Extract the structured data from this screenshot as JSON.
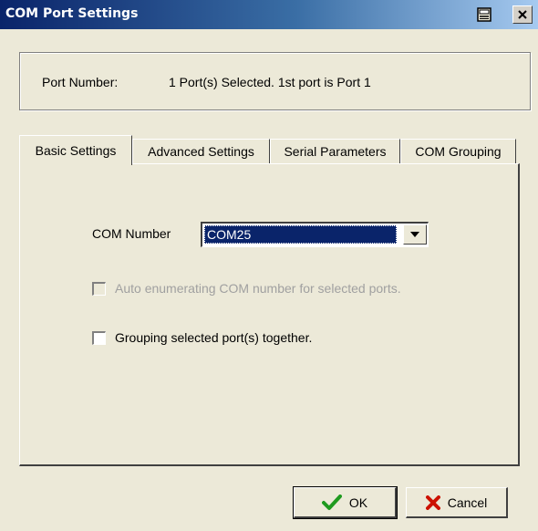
{
  "window": {
    "title": "COM Port Settings"
  },
  "port_info": {
    "label": "Port Number:",
    "value": "1 Port(s) Selected. 1st port is Port 1"
  },
  "tabs": [
    {
      "label": "Basic Settings",
      "active": true
    },
    {
      "label": "Advanced Settings",
      "active": false
    },
    {
      "label": "Serial Parameters",
      "active": false
    },
    {
      "label": "COM Grouping",
      "active": false
    }
  ],
  "basic": {
    "com_label": "COM Number",
    "com_value": "COM25",
    "auto_enum_label": "Auto enumerating COM number for selected ports.",
    "auto_enum_checked": false,
    "auto_enum_enabled": false,
    "grouping_label": "Grouping selected port(s) together.",
    "grouping_checked": false
  },
  "buttons": {
    "ok": "OK",
    "cancel": "Cancel"
  },
  "icons": {
    "print": "print-icon",
    "close": "close-icon",
    "dropdown": "dropdown-arrow-icon",
    "ok": "green-check-icon",
    "cancel": "red-x-icon"
  },
  "colors": {
    "titlebar_start": "#0a246a",
    "titlebar_end": "#a6caf0",
    "selection": "#0a246a",
    "ok_icon": "#1f9a1f",
    "cancel_icon": "#cc1100"
  }
}
